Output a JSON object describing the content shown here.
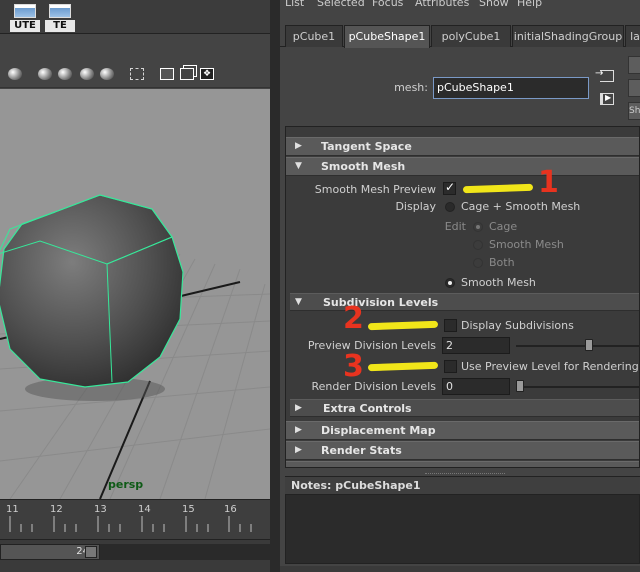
{
  "shelf": {
    "buttons": [
      {
        "label": "UTE"
      },
      {
        "label": "TE"
      }
    ]
  },
  "viewport": {
    "camera_label": "persp"
  },
  "timeline": {
    "ticks": [
      "11",
      "12",
      "13",
      "14",
      "15",
      "16"
    ],
    "range_end": "24"
  },
  "attribute_editor": {
    "menu": [
      "List",
      "Selected",
      "Focus",
      "Attributes",
      "Show",
      "Help"
    ],
    "tabs": [
      "pCube1",
      "pCubeShape1",
      "polyCube1",
      "initialShadingGroup",
      "la"
    ],
    "active_tab": "pCubeShape1",
    "mesh_label": "mesh:",
    "mesh_value": "pCubeShape1",
    "side_buttons": [
      "",
      "",
      "Sh"
    ],
    "sections": {
      "tangent_space": "Tangent Space",
      "smooth_mesh": "Smooth Mesh",
      "subdivision_levels": "Subdivision Levels",
      "extra_controls": "Extra Controls",
      "displacement_map": "Displacement Map",
      "render_stats": "Render Stats"
    },
    "smooth_mesh": {
      "preview_label": "Smooth Mesh Preview",
      "preview_checked": true,
      "display_label": "Display",
      "display_option_1": "Cage + Smooth Mesh",
      "edit_label": "Edit",
      "edit_options": [
        "Cage",
        "Smooth Mesh",
        "Both"
      ],
      "display_option_2": "Smooth Mesh",
      "display_selected": "Smooth Mesh"
    },
    "subdivision": {
      "display_subdivisions_label": "Display Subdivisions",
      "preview_levels_label": "Preview Division Levels",
      "preview_levels_value": "2",
      "use_preview_label": "Use Preview Level for Rendering",
      "render_levels_label": "Render Division Levels",
      "render_levels_value": "0"
    },
    "notes_label": "Notes:  pCubeShape1"
  },
  "annotations": [
    "1",
    "2",
    "3"
  ],
  "colors": {
    "annotation_number": "#e8331f",
    "annotation_highlight": "#f1e619",
    "wireframe": "#37e89a",
    "camera_label": "#0e5a16"
  }
}
